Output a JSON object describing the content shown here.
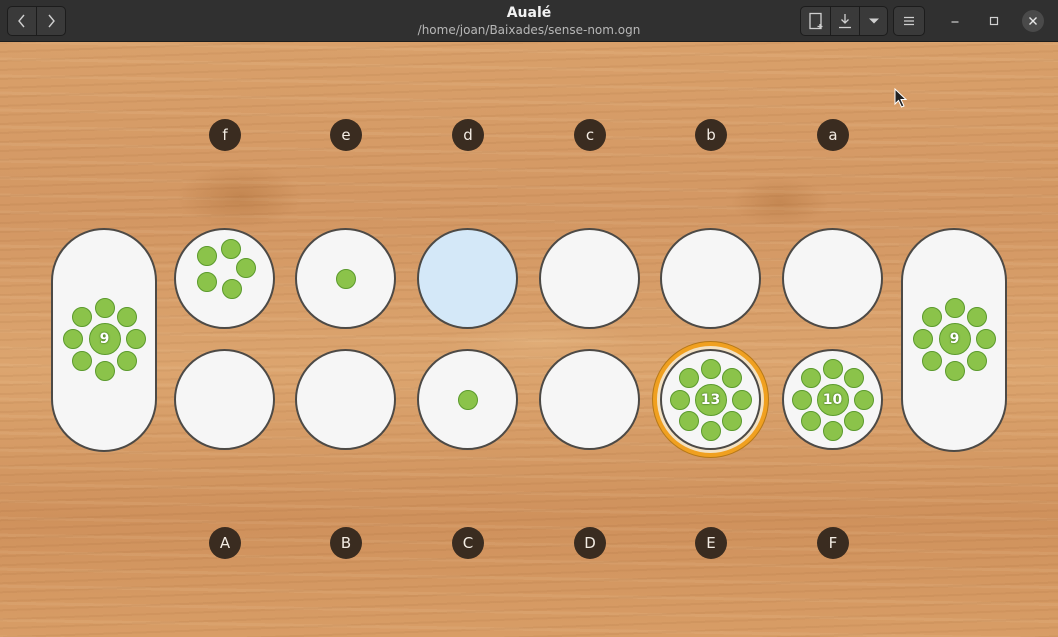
{
  "window": {
    "title": "Aualé",
    "subtitle": "/home/joan/Baixades/sense-nom.ogn",
    "back_icon": "chevron-left-icon",
    "forward_icon": "chevron-right-icon",
    "new_icon": "new-document-icon",
    "save_icon": "download-icon",
    "dropdown_icon": "caret-down-icon",
    "menu_icon": "hamburger-menu-icon"
  },
  "board": {
    "top_labels": [
      "f",
      "e",
      "d",
      "c",
      "b",
      "a"
    ],
    "bottom_labels": [
      "A",
      "B",
      "C",
      "D",
      "E",
      "F"
    ],
    "top_pits": [
      5,
      1,
      0,
      0,
      0,
      0
    ],
    "bottom_pits": [
      0,
      0,
      1,
      0,
      13,
      10
    ],
    "left_store": {
      "count": 9,
      "count_text": "9"
    },
    "right_store": {
      "count": 9,
      "count_text": "9"
    },
    "bottom_count_texts": {
      "E": "13",
      "F": "10"
    },
    "highlighted_top_pit": "d",
    "selected_bottom_pit": "E",
    "colors": {
      "seed": "#8bc34a",
      "highlight": "#d4e8f8",
      "selection_ring": "#f0a020",
      "label_bg": "#3a2c20"
    }
  }
}
